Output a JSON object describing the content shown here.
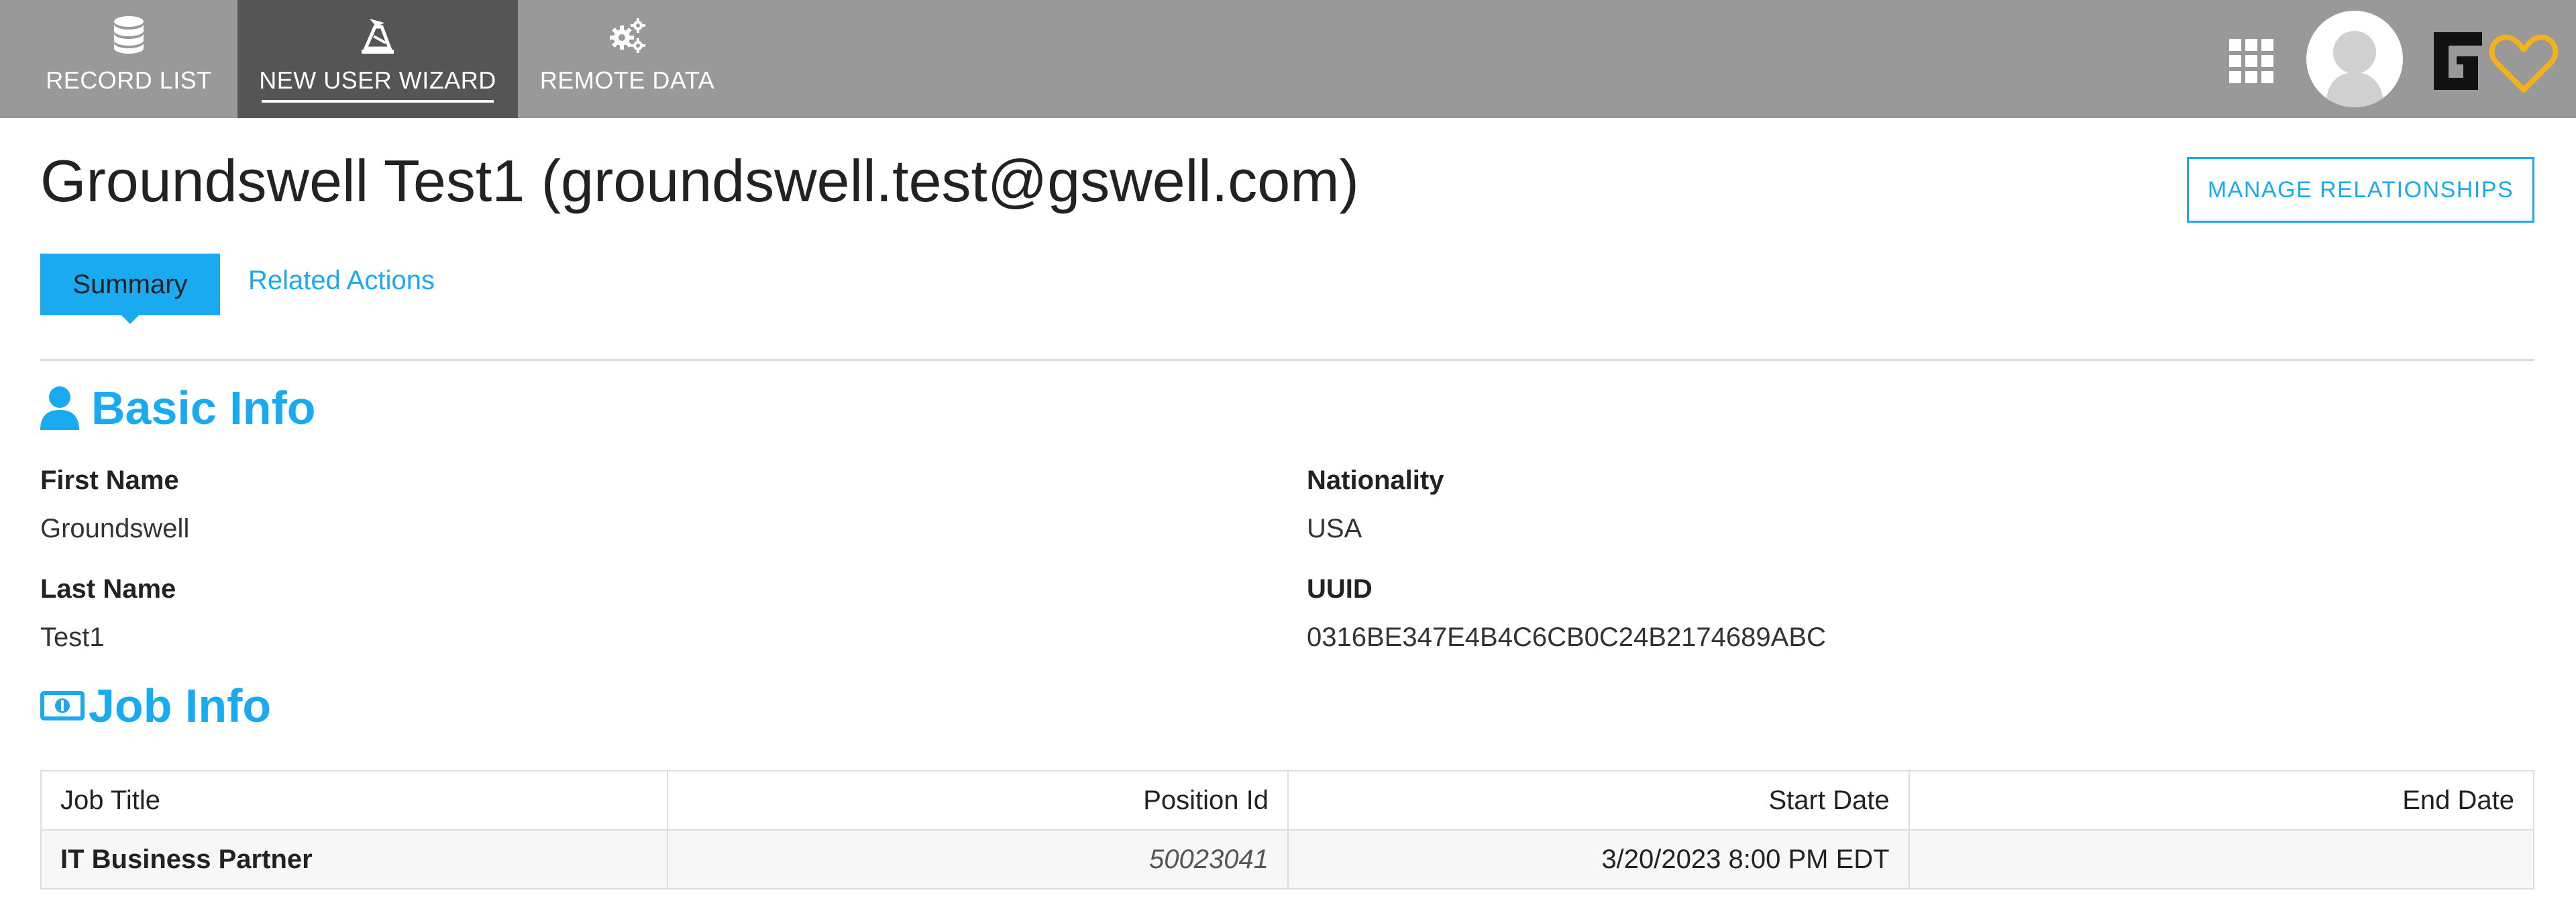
{
  "nav": {
    "tabs": [
      {
        "label": "RECORD LIST",
        "icon": "database-icon",
        "active": false
      },
      {
        "label": "NEW USER WIZARD",
        "icon": "wizard-icon",
        "active": true
      },
      {
        "label": "REMOTE DATA",
        "icon": "gears-icon",
        "active": false
      }
    ],
    "apps_icon": "apps-grid-icon",
    "avatar_icon": "user-avatar-icon",
    "logo_icon": "groundswell-logo-icon"
  },
  "header": {
    "title": "Groundswell Test1 (groundswell.test@gswell.com)",
    "manage_button": "MANAGE RELATIONSHIPS"
  },
  "subtabs": {
    "summary": "Summary",
    "related": "Related Actions"
  },
  "basic_info": {
    "heading": "Basic Info",
    "icon": "user-icon",
    "first_name_label": "First Name",
    "first_name": "Groundswell",
    "last_name_label": "Last Name",
    "last_name": "Test1",
    "nationality_label": "Nationality",
    "nationality": "USA",
    "uuid_label": "UUID",
    "uuid": "0316BE347E4B4C6CB0C24B2174689ABC"
  },
  "job_info": {
    "heading": "Job Info",
    "icon": "money-icon",
    "columns": [
      "Job Title",
      "Position Id",
      "Start Date",
      "End Date"
    ],
    "rows": [
      {
        "job_title": "IT Business Partner",
        "position_id": "50023041",
        "start_date": "3/20/2023 8:00 PM EDT",
        "end_date": ""
      }
    ]
  },
  "colors": {
    "accent": "#1aaaf0",
    "topbar": "#999999",
    "active_tab": "#555555"
  }
}
